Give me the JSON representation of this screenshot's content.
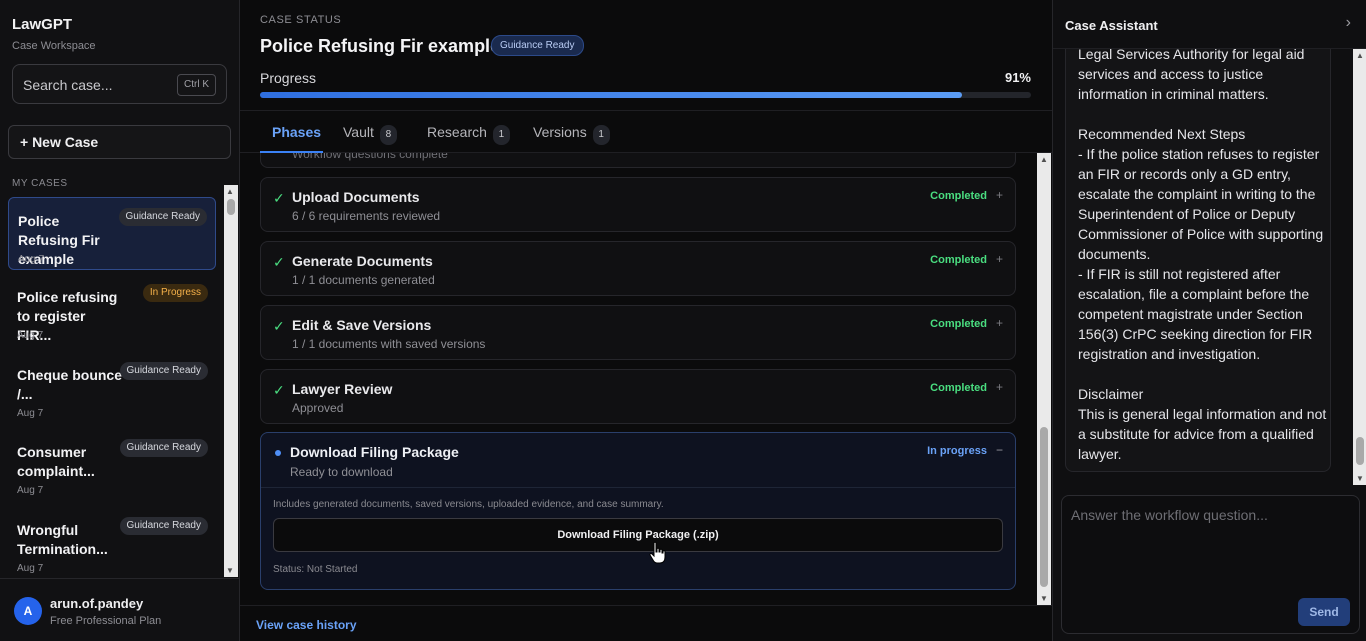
{
  "sidebar": {
    "brand": "LawGPT",
    "subtitle": "Case Workspace",
    "search_placeholder": "Search case...",
    "search_shortcut": "Ctrl K",
    "new_case_label": "+ New Case",
    "section_label": "MY CASES",
    "cases": [
      {
        "title": "Police Refusing Fir example",
        "date": "Aug 7",
        "status": "Guidance Ready"
      },
      {
        "title": "Police refusing to register FIR...",
        "date": "Aug 7",
        "status": "In Progress"
      },
      {
        "title": "Cheque bounce /...",
        "date": "Aug 7",
        "status": "Guidance Ready"
      },
      {
        "title": "Consumer complaint...",
        "date": "Aug 7",
        "status": "Guidance Ready"
      },
      {
        "title": "Wrongful Termination...",
        "date": "Aug 7",
        "status": "Guidance Ready"
      }
    ],
    "user": {
      "initial": "A",
      "name": "arun.of.pandey",
      "plan": "Free Professional Plan"
    }
  },
  "main": {
    "eyebrow": "CASE STATUS",
    "title": "Police Refusing Fir example",
    "status_badge": "Guidance Ready",
    "progress_label": "Progress",
    "progress_text": "91%",
    "progress_value": 91,
    "tabs": [
      {
        "label": "Phases",
        "count": ""
      },
      {
        "label": "Vault",
        "count": "8"
      },
      {
        "label": "Research",
        "count": "1"
      },
      {
        "label": "Versions",
        "count": "1"
      }
    ],
    "phases_top_sub": "Workflow questions complete",
    "phases": [
      {
        "name": "Upload Documents",
        "sub": "6 / 6 requirements reviewed",
        "status": "Completed",
        "toggle": "+"
      },
      {
        "name": "Generate Documents",
        "sub": "1 / 1 documents generated",
        "status": "Completed",
        "toggle": "+"
      },
      {
        "name": "Edit & Save Versions",
        "sub": "1 / 1 documents with saved versions",
        "status": "Completed",
        "toggle": "+"
      },
      {
        "name": "Lawyer Review",
        "sub": "Approved",
        "status": "Completed",
        "toggle": "+"
      }
    ],
    "active_phase": {
      "name": "Download Filing Package",
      "sub": "Ready to download",
      "status": "In progress",
      "toggle": "−",
      "description": "Includes generated documents, saved versions, uploaded evidence, and case summary.",
      "button_label": "Download Filing Package (.zip)",
      "status_line": "Status: Not Started"
    },
    "history_link": "View case history"
  },
  "assistant": {
    "title": "Case Assistant",
    "message": "Legal Services Authority for legal aid services and access to justice information in criminal matters.\n\nRecommended Next Steps\n- If the police station refuses to register an FIR or records only a GD entry, escalate the complaint in writing to the Superintendent of Police or Deputy Commissioner of Police with supporting documents.\n- If FIR is still not registered after escalation, file a complaint before the competent magistrate under Section 156(3) CrPC seeking direction for FIR registration and investigation.\n\nDisclaimer\nThis is general legal information and not a substitute for advice from a qualified lawyer.",
    "input_placeholder": "Answer the workflow question...",
    "send_label": "Send"
  },
  "colors": {
    "accent": "#3b82f6",
    "success": "#4ade80",
    "warning": "#f5b14a"
  }
}
